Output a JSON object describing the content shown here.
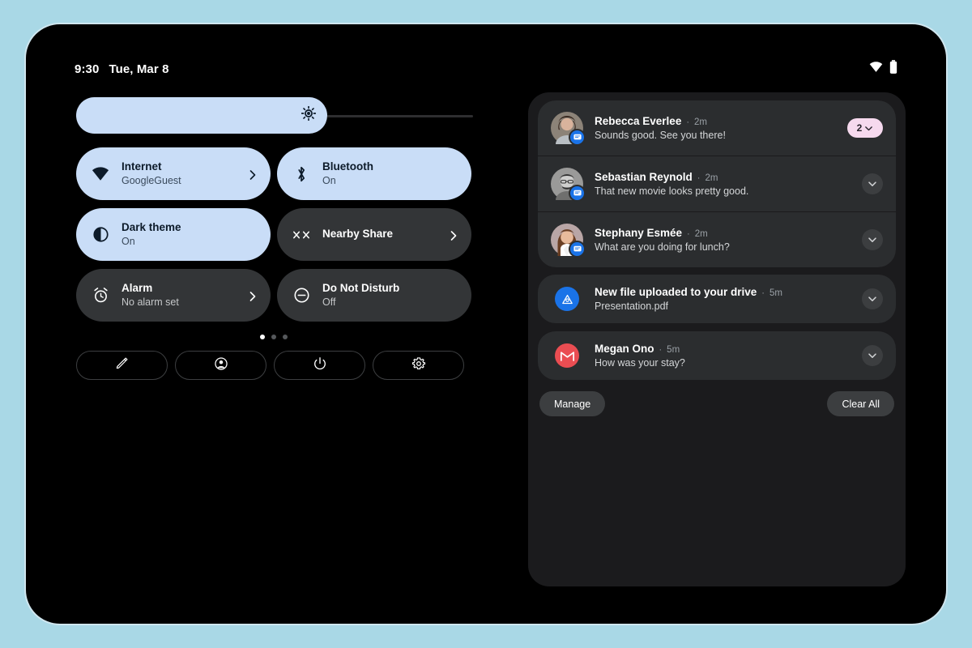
{
  "statusbar": {
    "time": "9:30",
    "date": "Tue, Mar 8",
    "wifi_icon": "wifi-icon",
    "battery_icon": "battery-icon"
  },
  "brightness": {
    "name": "brightness-slider",
    "icon": "brightness-icon",
    "value_percent": 63
  },
  "tiles": [
    {
      "label": "Internet",
      "sub": "GoogleGuest",
      "icon": "wifi-icon",
      "active": true,
      "chevron": true
    },
    {
      "label": "Bluetooth",
      "sub": "On",
      "icon": "bluetooth-icon",
      "active": true,
      "chevron": false
    },
    {
      "label": "Dark theme",
      "sub": "On",
      "icon": "dark-theme-icon",
      "active": true,
      "chevron": false
    },
    {
      "label": "Nearby Share",
      "sub": "",
      "icon": "nearby-share-icon",
      "active": false,
      "chevron": true
    },
    {
      "label": "Alarm",
      "sub": "No alarm set",
      "icon": "alarm-icon",
      "active": false,
      "chevron": true
    },
    {
      "label": "Do Not Disturb",
      "sub": "Off",
      "icon": "do-not-disturb-icon",
      "active": false,
      "chevron": false
    }
  ],
  "pager": {
    "total": 3,
    "active_index": 0
  },
  "footer_buttons": [
    {
      "name": "edit-tiles-button",
      "icon": "pencil-icon"
    },
    {
      "name": "user-switch-button",
      "icon": "account-circle-icon"
    },
    {
      "name": "power-button",
      "icon": "power-icon"
    },
    {
      "name": "settings-button",
      "icon": "gear-icon"
    }
  ],
  "notifications": {
    "group": [
      {
        "name": "Rebecca Everlee",
        "time": "2m",
        "message": "Sounds good. See you there!",
        "app_badge": "messages-icon",
        "avatar_kind": "photo-rebecca",
        "count": "2",
        "control": "count-badge"
      },
      {
        "name": "Sebastian Reynold",
        "time": "2m",
        "message": "That new movie looks pretty good.",
        "app_badge": "messages-icon",
        "avatar_kind": "photo-sebastian",
        "control": "expand-button"
      },
      {
        "name": "Stephany Esmée",
        "time": "2m",
        "message": "What are you doing for lunch?",
        "app_badge": "messages-icon",
        "avatar_kind": "photo-stephany",
        "control": "expand-button"
      }
    ],
    "solo": [
      {
        "name": "New file uploaded to your drive",
        "time": "5m",
        "message": "Presentation.pdf",
        "app_icon": "drive-icon",
        "control": "expand-button"
      },
      {
        "name": "Megan Ono",
        "time": "5m",
        "message": "How was your stay?",
        "app_icon": "gmail-icon",
        "control": "expand-button"
      }
    ],
    "separator": "·",
    "manage_label": "Manage",
    "clear_all_label": "Clear All"
  },
  "colors": {
    "page_background": "#a9d8e6",
    "device_frame": "#000000",
    "tile_active": "#c9ddf7",
    "tile_inactive": "#333537",
    "shade_background": "#1b1b1d",
    "notification_card": "#2b2d2f",
    "badge_pink": "#f6d9ee",
    "drive_blue": "#1a73e8",
    "gmail_red": "#ea4d52"
  }
}
